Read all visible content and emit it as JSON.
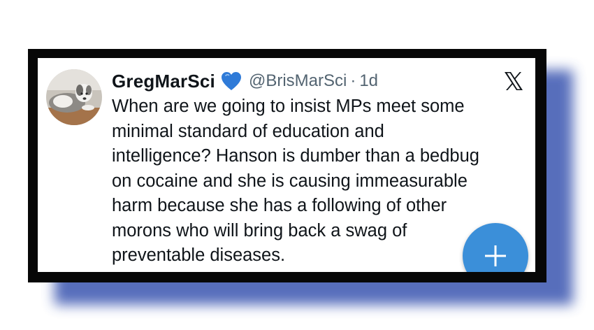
{
  "tweet": {
    "display_name": "GregMarSci",
    "handle": "@BrisMarSci",
    "separator": "·",
    "time": "1d",
    "text": "When are we going to insist MPs meet some\nminimal standard of education and\nintelligence? Hanson is dumber than a bedbug\non cocaine and she is causing immeasurable\nharm because she has a following of other\nmorons who will bring back a swag of\npreventable diseases."
  },
  "icons": {
    "badge": "blue-heart-icon",
    "platform": "x-logo-icon",
    "compose": "plus-icon"
  },
  "colors": {
    "frame": "#070707",
    "shadow": "#3a55b0",
    "heart": "#2f7bd8",
    "fab": "#3b8fd9",
    "text": "#0f1419",
    "muted": "#536471"
  }
}
